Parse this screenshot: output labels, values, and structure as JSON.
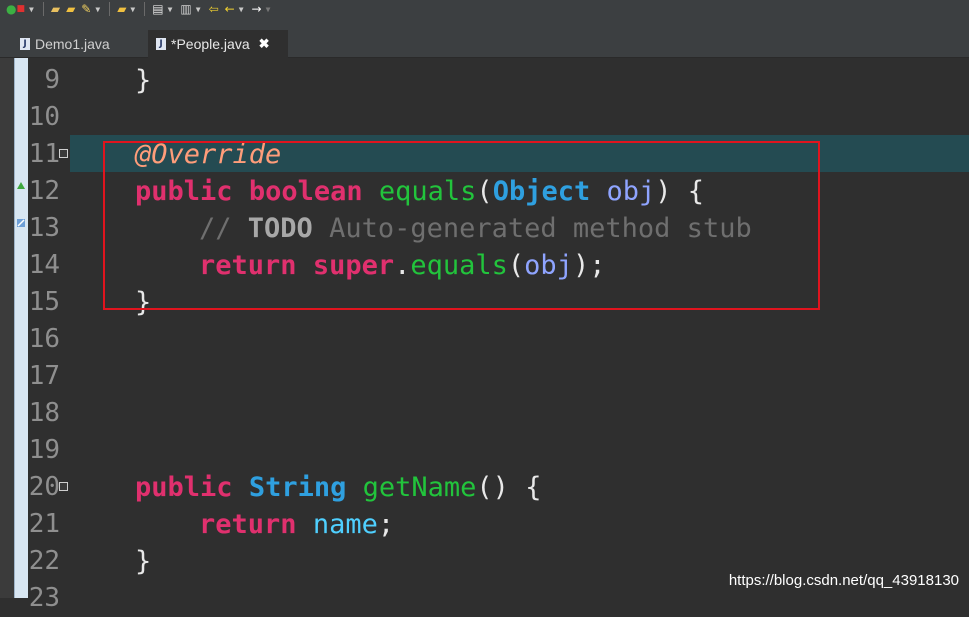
{
  "toolbar": {
    "buttons": [
      "debug-run",
      "open-type",
      "open-folder",
      "edit",
      "open-file",
      "search",
      "bookmark",
      "back-history",
      "back",
      "forward"
    ]
  },
  "tabs": [
    {
      "label": "Demo1.java",
      "active": false
    },
    {
      "label": "*People.java",
      "active": true
    }
  ],
  "editor": {
    "line_numbers": [
      "9",
      "10",
      "11",
      "12",
      "13",
      "14",
      "15",
      "16",
      "17",
      "18",
      "19",
      "20",
      "21",
      "22",
      "23"
    ],
    "lines": {
      "l9": "}",
      "l11_annotation": "@Override",
      "l12_public": "public",
      "l12_boolean": "boolean",
      "l12_method": "equals",
      "l12_open": "(",
      "l12_type": "Object",
      "l12_param": "obj",
      "l12_close": ") {",
      "l13_slashes": "// ",
      "l13_todo": "TODO",
      "l13_comment": " Auto-generated method stub",
      "l14_return": "return",
      "l14_super": "super",
      "l14_dot": ".",
      "l14_method": "equals",
      "l14_open": "(",
      "l14_param": "obj",
      "l14_close": ");",
      "l15": "}",
      "l20_public": "public",
      "l20_type": "String",
      "l20_method": "getName",
      "l20_rest": "() {",
      "l21_return": "return",
      "l21_field": "name",
      "l21_semi": ";",
      "l22": "}"
    }
  },
  "watermark": "https://blog.csdn.net/qq_43918130",
  "colors": {
    "highlight_line": "#244b52",
    "red_box": "#e0141e",
    "keyword": "#e0306e",
    "type": "#2fa0e0",
    "method": "#22c43c",
    "annotation": "#ff9d7a"
  }
}
